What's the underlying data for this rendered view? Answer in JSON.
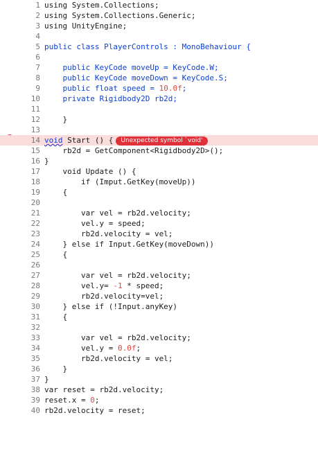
{
  "editor": {
    "lines": [
      {
        "n": "1",
        "t": [
          {
            "c": "using System.Collections;",
            "k": "p"
          }
        ]
      },
      {
        "n": "2",
        "t": [
          {
            "c": "using System.Collections.Generic;",
            "k": "p"
          }
        ]
      },
      {
        "n": "3",
        "t": [
          {
            "c": "using UnityEngine;",
            "k": "p"
          }
        ]
      },
      {
        "n": "4",
        "t": []
      },
      {
        "n": "5",
        "t": [
          {
            "c": "public class PlayerControls : MonoBehaviour {",
            "k": "k"
          }
        ]
      },
      {
        "n": "6",
        "t": []
      },
      {
        "n": "7",
        "t": [
          {
            "c": "    public KeyCode moveUp = KeyCode.W;",
            "k": "k"
          }
        ]
      },
      {
        "n": "8",
        "t": [
          {
            "c": "    public KeyCode moveDown = KeyCode.S;",
            "k": "k"
          }
        ]
      },
      {
        "n": "9",
        "t": [
          {
            "c": "    public float speed = ",
            "k": "k"
          },
          {
            "c": "10.0f",
            "k": "n"
          },
          {
            "c": ";",
            "k": "k"
          }
        ]
      },
      {
        "n": "10",
        "t": [
          {
            "c": "    private Rigidbody2D rb2d;",
            "k": "k"
          }
        ]
      },
      {
        "n": "11",
        "t": []
      },
      {
        "n": "12",
        "t": [
          {
            "c": "    }",
            "k": "p"
          }
        ]
      },
      {
        "n": "13",
        "t": []
      },
      {
        "n": "14",
        "err": true,
        "t": [
          {
            "c": "void",
            "k": "sq"
          },
          {
            "c": " Start () {",
            "k": "p"
          }
        ]
      },
      {
        "n": "15",
        "t": [
          {
            "c": "    rb2d = GetComponent<Rigidbody2D>();",
            "k": "p"
          }
        ]
      },
      {
        "n": "16",
        "t": [
          {
            "c": "}",
            "k": "p"
          }
        ]
      },
      {
        "n": "17",
        "t": [
          {
            "c": "    void Update () {",
            "k": "p"
          }
        ]
      },
      {
        "n": "18",
        "t": [
          {
            "c": "        if (Imput.GetKey(moveUp))",
            "k": "p"
          }
        ]
      },
      {
        "n": "19",
        "t": [
          {
            "c": "    {",
            "k": "p"
          }
        ]
      },
      {
        "n": "20",
        "t": []
      },
      {
        "n": "21",
        "t": [
          {
            "c": "        var vel = rb2d.velocity;",
            "k": "p"
          }
        ]
      },
      {
        "n": "22",
        "t": [
          {
            "c": "        vel.y = speed;",
            "k": "p"
          }
        ]
      },
      {
        "n": "23",
        "t": [
          {
            "c": "        rb2d.velocity = vel;",
            "k": "p"
          }
        ]
      },
      {
        "n": "24",
        "t": [
          {
            "c": "    } else if Input.GetKey(moveDown))",
            "k": "p"
          }
        ]
      },
      {
        "n": "25",
        "t": [
          {
            "c": "    {",
            "k": "p"
          }
        ]
      },
      {
        "n": "26",
        "t": []
      },
      {
        "n": "27",
        "t": [
          {
            "c": "        var vel = rb2d.velocity;",
            "k": "p"
          }
        ]
      },
      {
        "n": "28",
        "t": [
          {
            "c": "        vel.y= ",
            "k": "p"
          },
          {
            "c": "-1",
            "k": "n"
          },
          {
            "c": " * speed;",
            "k": "p"
          }
        ]
      },
      {
        "n": "29",
        "t": [
          {
            "c": "        rb2d.velocity=vel;",
            "k": "p"
          }
        ]
      },
      {
        "n": "30",
        "t": [
          {
            "c": "    } else if (!Input.anyKey)",
            "k": "p"
          }
        ]
      },
      {
        "n": "31",
        "t": [
          {
            "c": "    {",
            "k": "p"
          }
        ]
      },
      {
        "n": "32",
        "t": []
      },
      {
        "n": "33",
        "t": [
          {
            "c": "        var vel = rb2d.velocity;",
            "k": "p"
          }
        ]
      },
      {
        "n": "34",
        "t": [
          {
            "c": "        vel.y = ",
            "k": "p"
          },
          {
            "c": "0.0f",
            "k": "n"
          },
          {
            "c": ";",
            "k": "p"
          }
        ]
      },
      {
        "n": "35",
        "t": [
          {
            "c": "        rb2d.velocity = vel;",
            "k": "p"
          }
        ]
      },
      {
        "n": "36",
        "t": [
          {
            "c": "    }",
            "k": "p"
          }
        ]
      },
      {
        "n": "37",
        "t": [
          {
            "c": "}",
            "k": "p"
          }
        ]
      },
      {
        "n": "38",
        "t": [
          {
            "c": "var reset = rb2d.velocity;",
            "k": "p"
          }
        ]
      },
      {
        "n": "39",
        "t": [
          {
            "c": "reset.x = ",
            "k": "p"
          },
          {
            "c": "0",
            "k": "n"
          },
          {
            "c": ";",
            "k": "p"
          }
        ]
      },
      {
        "n": "40",
        "t": [
          {
            "c": "rb2d.velocity = reset;",
            "k": "p"
          }
        ]
      }
    ],
    "error_badge": "Unexpected symbol `void'",
    "error_icon": "error-icon",
    "colors": {
      "keyword": "#0b3fd4",
      "number": "#e0463c",
      "error": "#e0303a",
      "error_line_bg": "#fbdcdc"
    }
  }
}
